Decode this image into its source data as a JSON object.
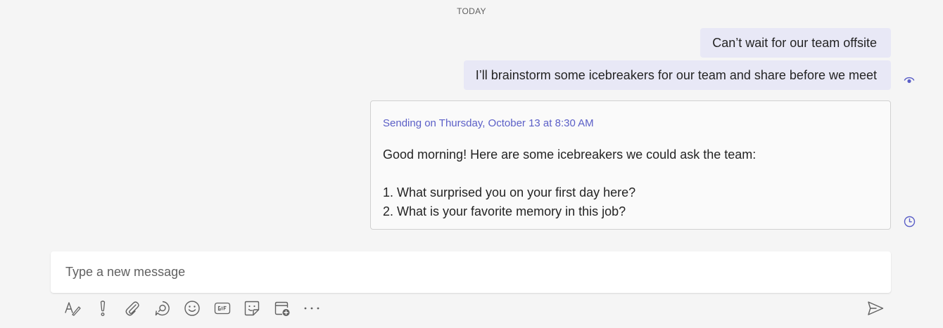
{
  "conversation": {
    "day_divider": "TODAY",
    "messages": [
      {
        "text": "Can’t wait for our team offsite"
      },
      {
        "text": "I’ll brainstorm some icebreakers for our team and share before we meet"
      }
    ],
    "read_receipt_icon": "seen-eye-icon",
    "scheduled_message": {
      "label": "Sending on Thursday, October 13 at 8:30 AM",
      "intro": "Good morning! Here are some icebreakers we could ask the team:",
      "items": [
        "1. What surprised you on your first day here?",
        "2. What is your favorite memory in this job?"
      ],
      "status_icon": "clock-icon"
    }
  },
  "compose": {
    "placeholder": "Type a new message",
    "toolbar": [
      {
        "icon": "format-icon"
      },
      {
        "icon": "important-icon"
      },
      {
        "icon": "attach-icon"
      },
      {
        "icon": "loop-icon"
      },
      {
        "icon": "emoji-icon"
      },
      {
        "icon": "gif-icon"
      },
      {
        "icon": "sticker-icon"
      },
      {
        "icon": "schedule-meeting-icon"
      },
      {
        "icon": "more-options-icon"
      }
    ],
    "send_icon": "send-icon"
  },
  "colors": {
    "background": "#f5f5f5",
    "bubble": "#e8e8f6",
    "accent": "#5b5fc7",
    "icon": "#616161"
  }
}
